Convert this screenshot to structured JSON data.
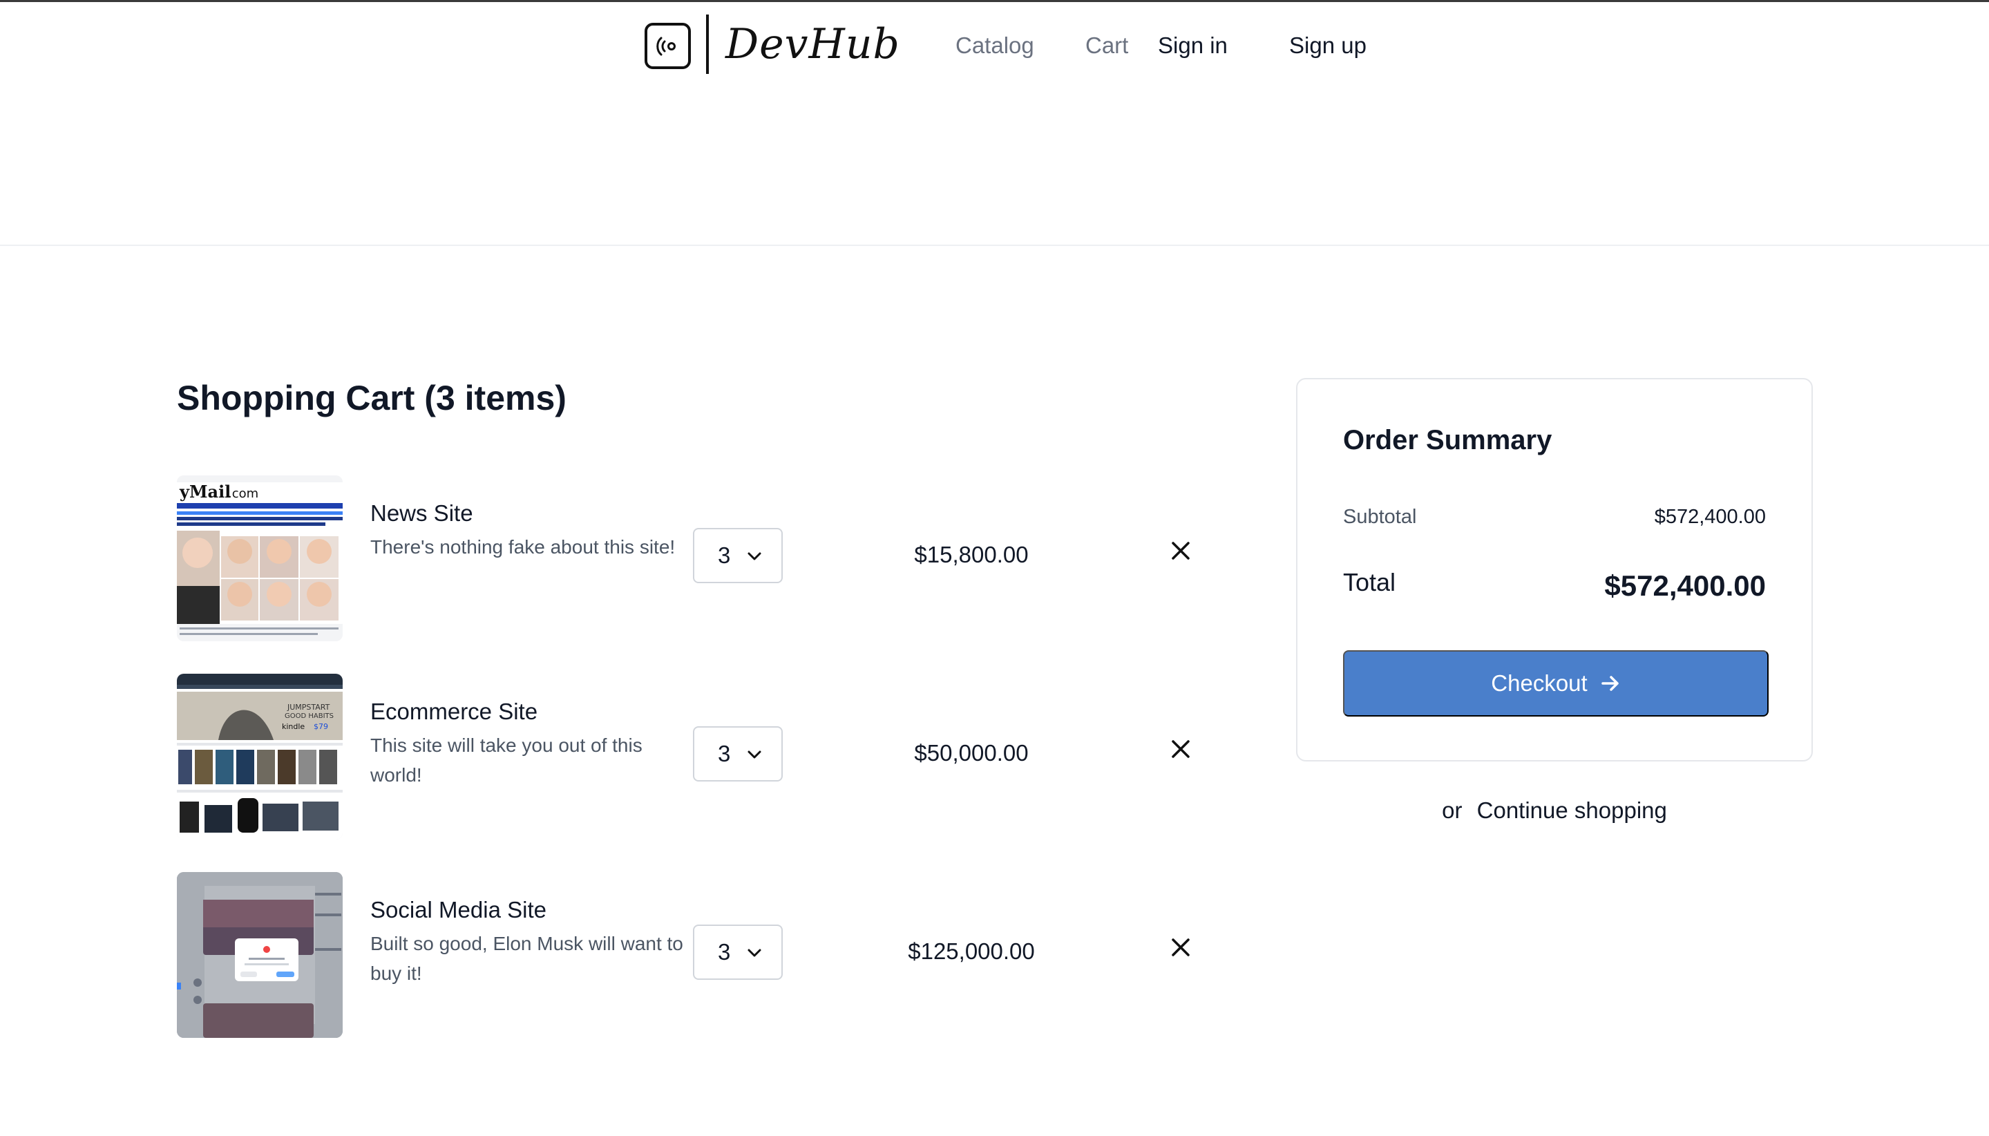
{
  "brand": {
    "name": "DevHub",
    "logo_icon": "broadcast-icon"
  },
  "nav": {
    "catalog": "Catalog",
    "cart": "Cart",
    "sign_in": "Sign in",
    "sign_up": "Sign up"
  },
  "cart": {
    "title": "Shopping Cart (3 items)",
    "items": [
      {
        "name": "News Site",
        "description": "There's nothing fake about this site!",
        "quantity": "3",
        "price": "$15,800.00",
        "thumbnail": "news-site-screenshot"
      },
      {
        "name": "Ecommerce Site",
        "description": "This site will take you out of this world!",
        "quantity": "3",
        "price": "$50,000.00",
        "thumbnail": "ecommerce-site-screenshot"
      },
      {
        "name": "Social Media Site",
        "description": "Built so good, Elon Musk will want to buy it!",
        "quantity": "3",
        "price": "$125,000.00",
        "thumbnail": "social-media-site-screenshot"
      }
    ]
  },
  "summary": {
    "title": "Order Summary",
    "subtotal_label": "Subtotal",
    "subtotal_value": "$572,400.00",
    "total_label": "Total",
    "total_value": "$572,400.00",
    "checkout_label": "Checkout",
    "continue_prefix": "or",
    "continue_label": "Continue shopping"
  },
  "colors": {
    "accent": "#4a7fcb",
    "muted": "#6b7280",
    "text": "#111827"
  }
}
